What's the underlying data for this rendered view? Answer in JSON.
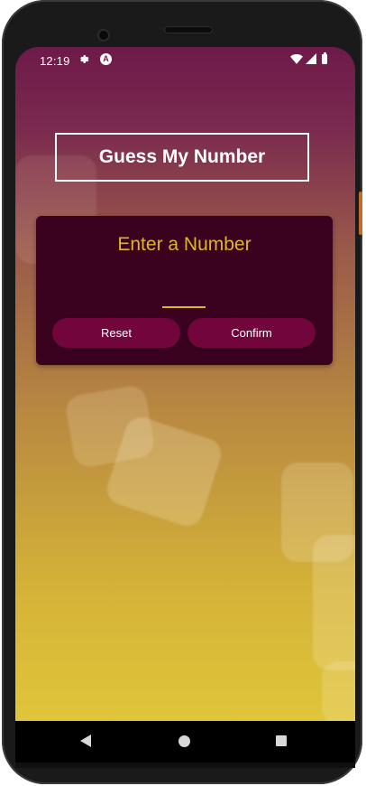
{
  "status_bar": {
    "time": "12:19",
    "settings_icon": "gear-icon",
    "app_icon": "android-a-icon",
    "app_icon_text": "A",
    "wifi_icon": "wifi-icon",
    "signal_icon": "cell-signal-icon",
    "battery_icon": "battery-icon"
  },
  "header": {
    "title": "Guess My Number"
  },
  "input_card": {
    "title": "Enter a Number",
    "input_value": "",
    "reset_label": "Reset",
    "confirm_label": "Confirm"
  },
  "nav_bar": {
    "back_icon": "back-triangle-icon",
    "home_icon": "home-circle-icon",
    "recents_icon": "recents-square-icon"
  },
  "colors": {
    "background_top": "#6e1a4a",
    "background_bottom": "#e0c53a",
    "card": "#3b021f",
    "accent": "#ddb52f",
    "button": "#72063c"
  }
}
